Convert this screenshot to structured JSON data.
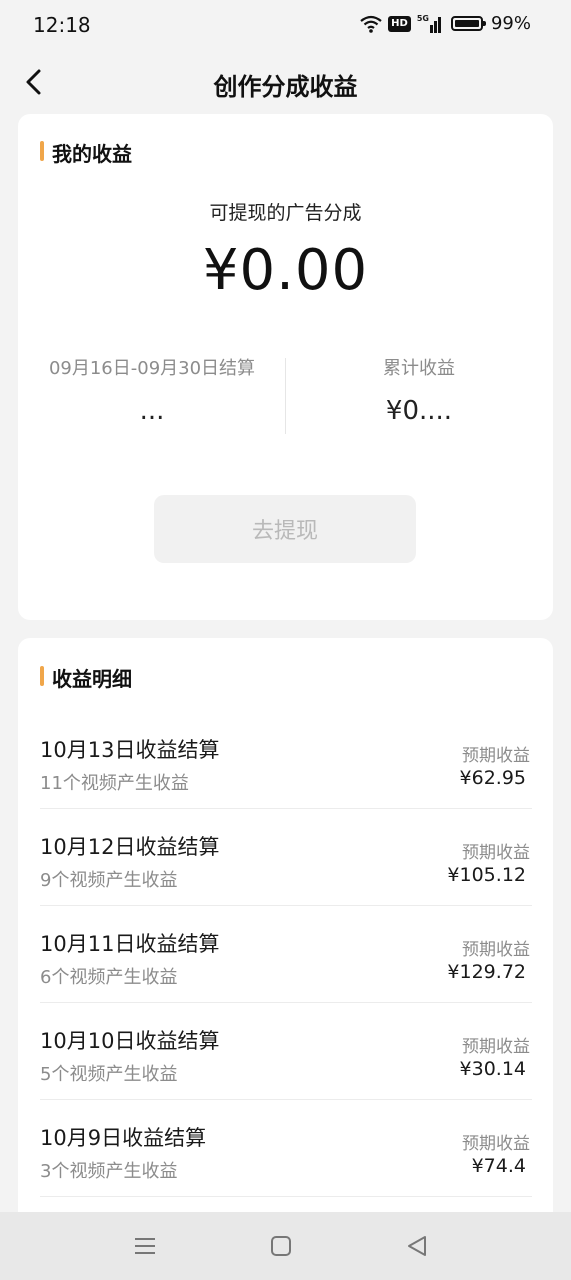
{
  "status_bar": {
    "time": "12:18",
    "hd_label": "HD",
    "network_label": "5G",
    "battery_percent": "99%",
    "battery_level": 0.99,
    "icons": [
      "wifi-icon",
      "hd-icon",
      "signal-5g-icon",
      "battery-icon"
    ]
  },
  "nav": {
    "title": "创作分成收益",
    "back_icon": "chevron-left-icon"
  },
  "earnings": {
    "section_title": "我的收益",
    "withdrawable_label": "可提现的广告分成",
    "withdrawable_amount": "¥0.00",
    "period_label": "09月16日-09月30日结算",
    "period_value": "...",
    "total_label": "累计收益",
    "total_value": "¥0....",
    "withdraw_button": "去提现"
  },
  "details": {
    "section_title": "收益明细",
    "items": [
      {
        "title": "10月13日收益结算",
        "sub": "11个视频产生收益",
        "label": "预期收益",
        "amount": "¥62.95"
      },
      {
        "title": "10月12日收益结算",
        "sub": "9个视频产生收益",
        "label": "预期收益",
        "amount": "¥105.12"
      },
      {
        "title": "10月11日收益结算",
        "sub": "6个视频产生收益",
        "label": "预期收益",
        "amount": "¥129.72"
      },
      {
        "title": "10月10日收益结算",
        "sub": "5个视频产生收益",
        "label": "预期收益",
        "amount": "¥30.14"
      },
      {
        "title": "10月9日收益结算",
        "sub": "3个视频产生收益",
        "label": "预期收益",
        "amount": "¥74.4"
      }
    ]
  },
  "system_nav": {
    "icons": [
      "menu-icon",
      "home-square-icon",
      "back-triangle-icon"
    ]
  },
  "colors": {
    "accent": "#f0a64a",
    "background": "#f3f3f3",
    "card": "#ffffff",
    "secondary_text": "#8c8c8c",
    "disabled_button": "#f1f1f1"
  }
}
